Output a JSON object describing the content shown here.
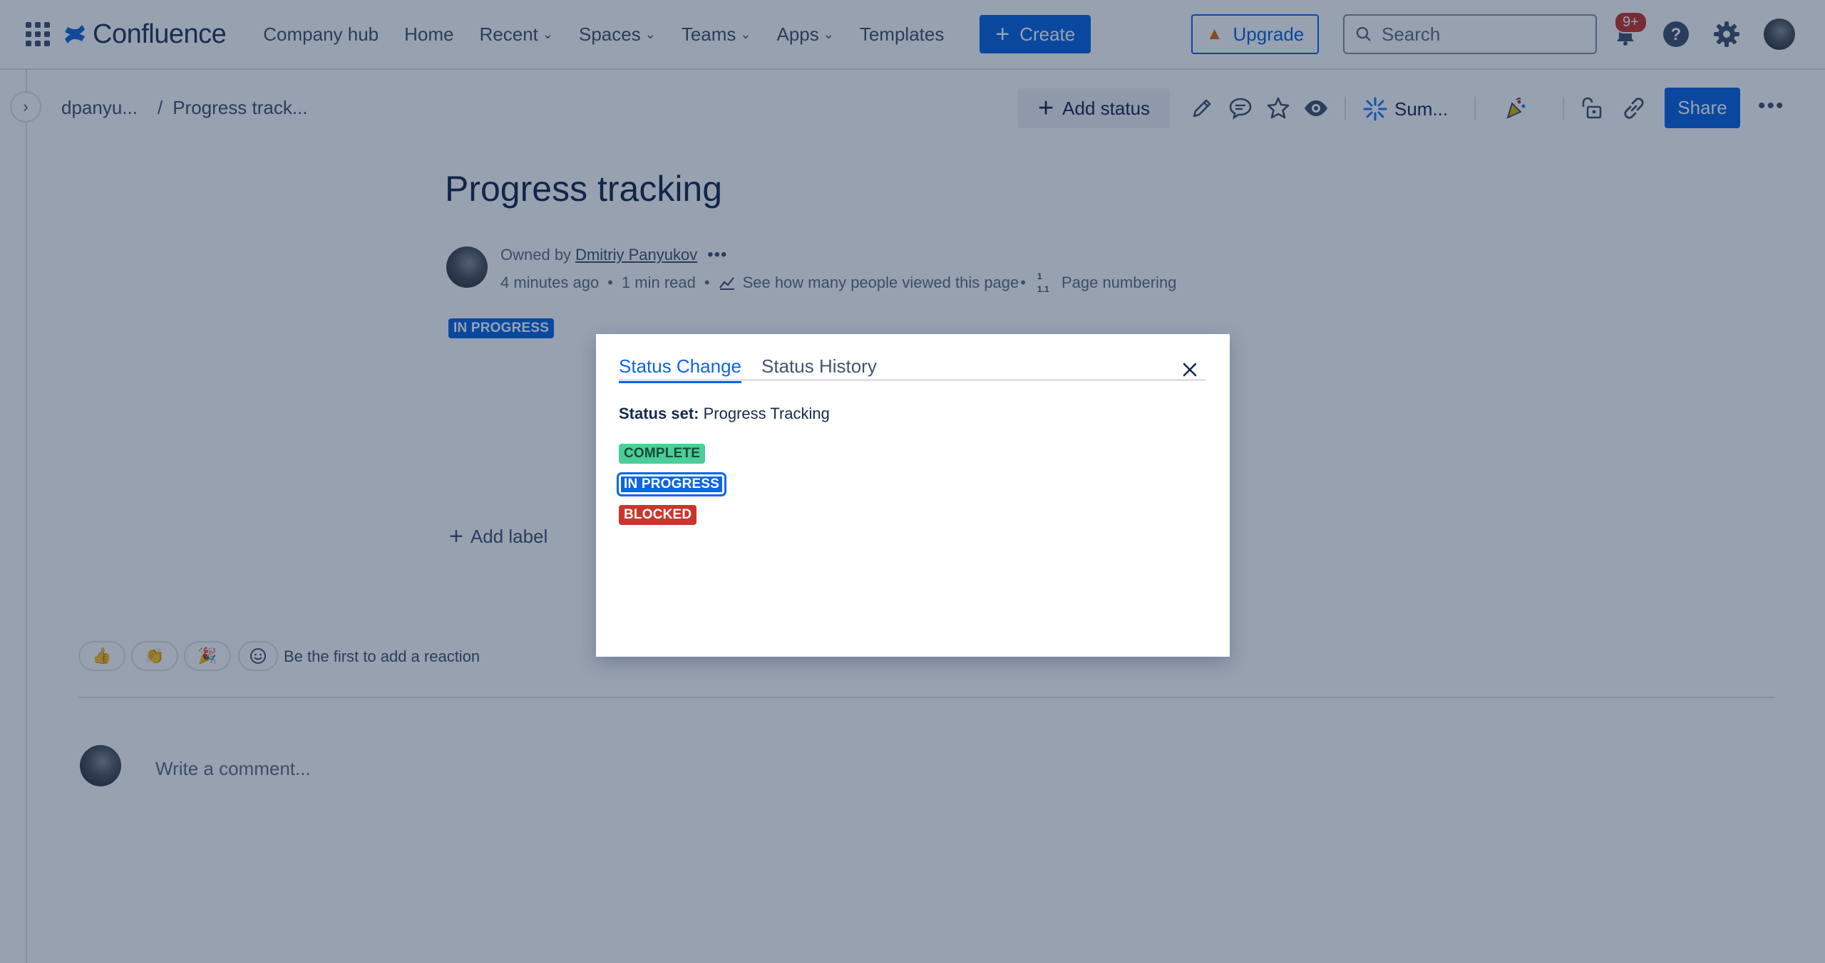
{
  "nav": {
    "app_name": "Confluence",
    "items": [
      "Company hub",
      "Home",
      "Recent",
      "Spaces",
      "Teams",
      "Apps",
      "Templates"
    ],
    "dropdown_items": [
      "Recent",
      "Spaces",
      "Teams",
      "Apps"
    ],
    "create_label": "Create",
    "upgrade_label": "Upgrade",
    "search_placeholder": "Search",
    "notifications_badge": "9+"
  },
  "breadcrumb": {
    "space": "dpanyu...",
    "separator": "/",
    "page": "Progress track..."
  },
  "toolbar": {
    "add_status_label": "Add status",
    "summarize_label": "Sum...",
    "share_label": "Share",
    "more_label": "•••"
  },
  "page": {
    "title": "Progress tracking",
    "owned_by_prefix": "Owned by",
    "owner": "Dmitriy Panyukov",
    "owner_menu": "•••",
    "updated": "4 minutes ago",
    "read_time": "1 min read",
    "views_link": "See how many people viewed this page",
    "page_numbering": "Page numbering",
    "status": "IN PROGRESS",
    "add_label": "Add label",
    "reactions_prompt": "Be the first to add a reaction",
    "comment_placeholder": "Write a comment..."
  },
  "modal": {
    "tabs": [
      "Status Change",
      "Status History"
    ],
    "active_tab": "Status Change",
    "status_set_label": "Status set:",
    "status_set_value": "Progress Tracking",
    "options": [
      {
        "label": "COMPLETE",
        "color": "#4bce97"
      },
      {
        "label": "IN PROGRESS",
        "color": "#0c66e4"
      },
      {
        "label": "BLOCKED",
        "color": "#c9372c"
      }
    ],
    "selected_option": "IN PROGRESS"
  },
  "colors": {
    "brand_blue": "#0c66e4",
    "overlay": "rgba(9,30,66,0.42)",
    "warning_orange": "#e56910"
  }
}
